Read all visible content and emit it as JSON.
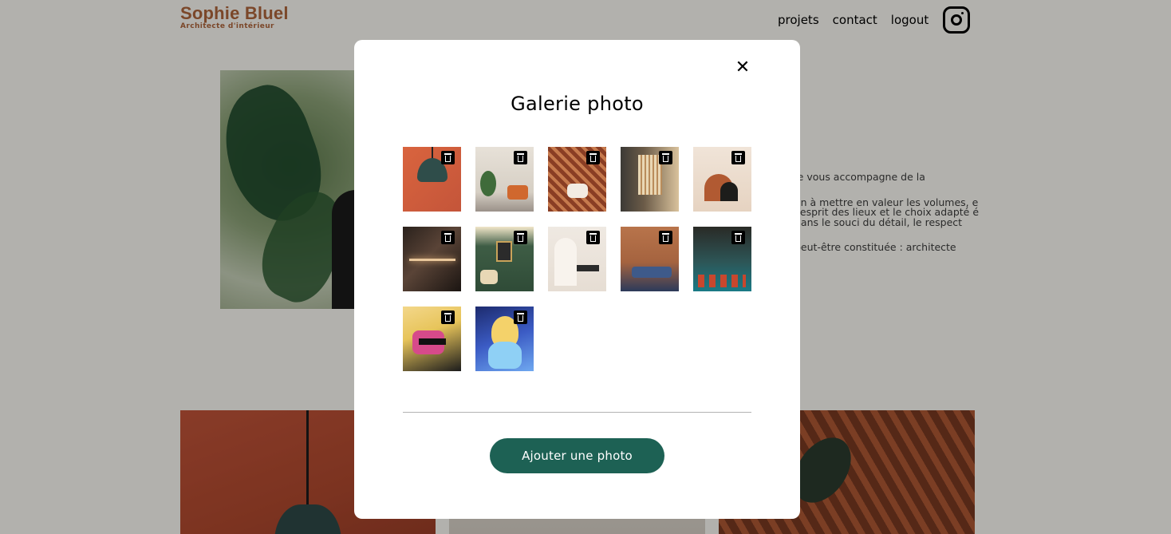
{
  "header": {
    "logo_name": "Sophie Bluel",
    "logo_subtitle": "Architecte d'intérieur",
    "nav": [
      {
        "label": "projets"
      },
      {
        "label": "contact"
      },
      {
        "label": "logout"
      }
    ],
    "instagram_icon": "instagram-icon"
  },
  "intro": {
    "paragraphs": [
      "Je vous accompagne de la",
      "on à mettre en valeur les volumes, e l'esprit des lieux et le choix adapté é dans le souci du détail, le respect",
      "peut-être constituée : architecte"
    ]
  },
  "modal": {
    "title": "Galerie photo",
    "close_label": "✕",
    "add_button_label": "Ajouter une photo",
    "delete_icon": "trash-icon",
    "photos": [
      {
        "name": "pendant-lamp"
      },
      {
        "name": "living-room-orange-sofa"
      },
      {
        "name": "greenhouse-lounge"
      },
      {
        "name": "wooden-screen-room"
      },
      {
        "name": "arch-wall-decor"
      },
      {
        "name": "dark-kitchen-shelf"
      },
      {
        "name": "green-wall-salon"
      },
      {
        "name": "white-arch-bench"
      },
      {
        "name": "blue-sofa-lounge"
      },
      {
        "name": "teal-bar-stools"
      },
      {
        "name": "anime-character"
      },
      {
        "name": "princess-illustration"
      }
    ]
  },
  "colors": {
    "brand": "#b1663c",
    "primary_button": "#1d6154",
    "overlay": "rgba(0,0,0,0.30)"
  }
}
